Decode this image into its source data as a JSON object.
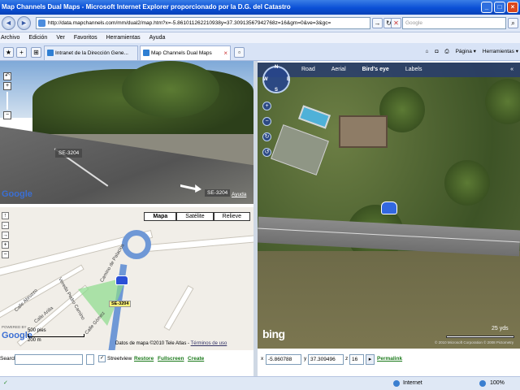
{
  "window": {
    "title": "Map Channels Dual Maps - Microsoft Internet Explorer proporcionado por la D.G. del Catastro",
    "buttons": {
      "minimize": "_",
      "maximize": "□",
      "close": "×"
    }
  },
  "address_bar": {
    "back": "◄",
    "forward": "►",
    "url": "http://data.mapchannels.com/mm/dual2/map.htm?x=-5.861011262210938y=37.30913567942768z=16&gm=0&ve=3&gc=",
    "go": "→",
    "refresh": "↻",
    "stop": "✕",
    "search_placeholder": "Google"
  },
  "menu": [
    "Archivo",
    "Edición",
    "Ver",
    "Favoritos",
    "Herramientas",
    "Ayuda"
  ],
  "tabs": [
    {
      "label": "Intranet de la Dirección Gene..."
    },
    {
      "label": "Map Channels Dual Maps"
    }
  ],
  "toolbar": {
    "home": "⌂",
    "page": "Página ▾",
    "tools": "Herramientas ▾"
  },
  "streetview": {
    "road_label": "SE-3204",
    "road_label_small": "SE-3204",
    "help_link": "Ayuda",
    "zoom_in": "+",
    "zoom_out": "−",
    "logo": "Google"
  },
  "map": {
    "types": [
      "Mapa",
      "Satélite",
      "Relieve"
    ],
    "active_type": "Mapa",
    "road_tag": "SE-3204",
    "streets": [
      "Calle Abruzzo",
      "Calle Arilla",
      "Vereda Pedro Camino",
      "Calle Gómez",
      "Camino de Palacios"
    ],
    "scale_top": "500 pies",
    "scale_bottom": "200 m",
    "copyright": "Datos de mapa ©2010 Tele Atlas -",
    "terms_link": "Términos de uso",
    "logo": "Google",
    "powered": "POWERED BY",
    "controls": {
      "up": "↑",
      "left": "←",
      "right": "→",
      "zoom_in": "+",
      "zoom_out": "−"
    }
  },
  "map_bottom": {
    "search_label": "Search:",
    "streetview_label": "Streetview",
    "restore": "Restore",
    "fullscreen": "Fullscreen",
    "create": "Create"
  },
  "birdseye": {
    "tabs": [
      "Road",
      "Aerial",
      "Bird's eye",
      "Labels"
    ],
    "active_tab": "Bird's eye",
    "collapse": "«",
    "compass": {
      "n": "N",
      "e": "E",
      "w": "W",
      "s": "S"
    },
    "controls": [
      "+",
      "−",
      "↻",
      "↺"
    ],
    "logo": "bing",
    "scale": "25 yds",
    "copyright": "© 2010 Microsoft Corporation © 2008 Pictometry"
  },
  "coords": {
    "x_label": "x",
    "x": "-5.860788",
    "y_label": "y",
    "y": "37.309496",
    "z_label": "z",
    "z": "16",
    "permalink": "Permalink"
  },
  "status": {
    "done": "✓",
    "zone": "Internet",
    "zoom": "100%"
  }
}
